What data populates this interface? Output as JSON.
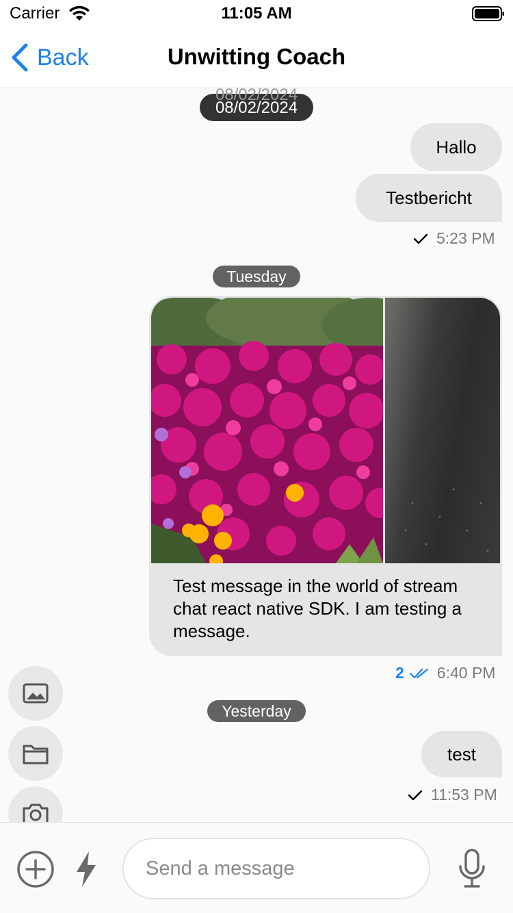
{
  "status_bar": {
    "carrier": "Carrier",
    "time": "11:05 AM",
    "icons": [
      "wifi-icon",
      "battery-icon"
    ]
  },
  "nav": {
    "back_label": "Back",
    "title": "Unwitting Coach",
    "accent_color": "#1a82f0"
  },
  "messages": {
    "date_pill_1": "08/02/2024",
    "date_pill_1_ghost": "08/02/2024",
    "msg_hallo": "Hallo",
    "msg_testbericht": "Testbericht",
    "meta_1_time": "5:23 PM",
    "date_pill_2": "Tuesday",
    "image_message_text": "Test message in the world of stream chat react native SDK. I am testing a message.",
    "meta_2_read_count": "2",
    "meta_2_time": "6:40 PM",
    "date_pill_3": "Yesterday",
    "msg_test": "test",
    "meta_3_time": "11:53 PM"
  },
  "attachment_picker": {
    "buttons": [
      "image-icon",
      "folder-icon",
      "camera-icon"
    ]
  },
  "composer": {
    "placeholder": "Send a message",
    "value": ""
  }
}
